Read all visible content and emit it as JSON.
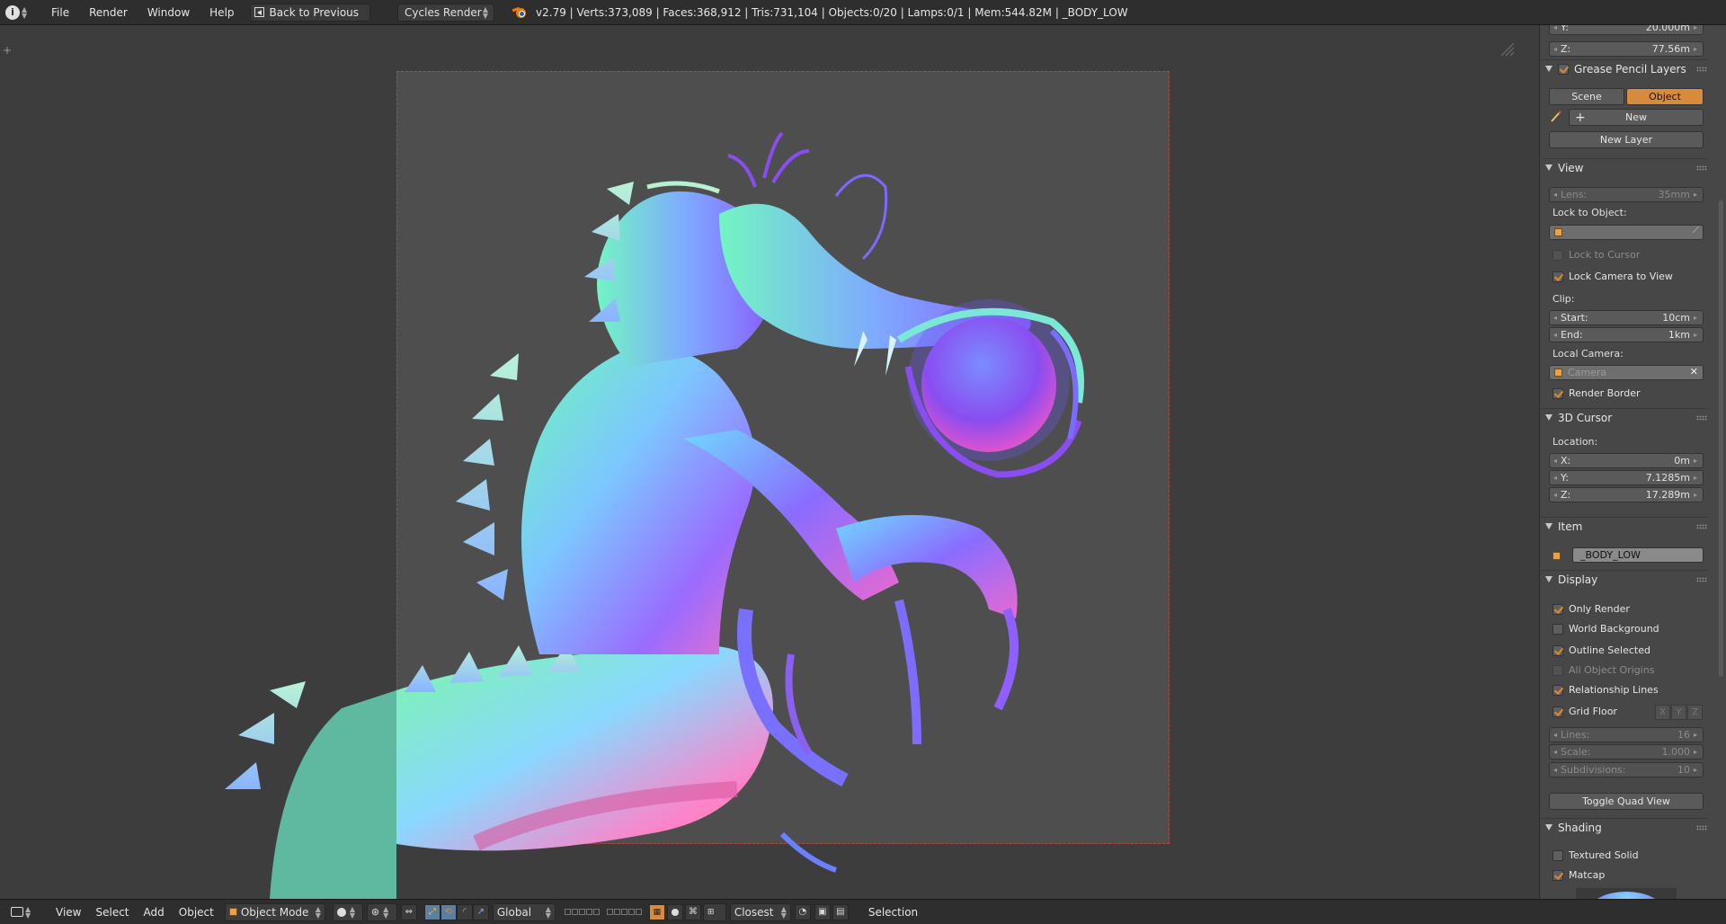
{
  "topbar": {
    "menu": [
      "File",
      "Render",
      "Window",
      "Help"
    ],
    "back_label": "Back to Previous",
    "render_engine": "Cycles Render",
    "stats": "v2.79 | Verts:373,089 | Faces:368,912 | Tris:731,104 | Objects:0/20 | Lamps:0/1 | Mem:544.82M | _BODY_LOW"
  },
  "npanel": {
    "partial_y_label": "Y:",
    "partial_y_value": "20.000m",
    "z_label": "Z:",
    "z_value": "77.56m",
    "grease": {
      "title": "Grease Pencil Layers",
      "scene_tab": "Scene",
      "object_tab": "Object",
      "new_label": "New",
      "new_layer_label": "New Layer"
    },
    "view": {
      "title": "View",
      "lens_label": "Lens:",
      "lens_value": "35mm",
      "lock_to_object_label": "Lock to Object:",
      "lock_to_cursor_label": "Lock to Cursor",
      "lock_camera_label": "Lock Camera to View",
      "clip_label": "Clip:",
      "start_label": "Start:",
      "start_value": "10cm",
      "end_label": "End:",
      "end_value": "1km",
      "local_camera_label": "Local Camera:",
      "local_camera_placeholder": "Camera",
      "render_border_label": "Render Border"
    },
    "cursor": {
      "title": "3D Cursor",
      "location_label": "Location:",
      "x_label": "X:",
      "x_value": "0m",
      "y_label": "Y:",
      "y_value": "7.1285m",
      "z_label": "Z:",
      "z_value": "17.289m"
    },
    "item": {
      "title": "Item",
      "name": "_BODY_LOW"
    },
    "display": {
      "title": "Display",
      "only_render": "Only Render",
      "world_background": "World Background",
      "outline_selected": "Outline Selected",
      "all_object_origins": "All Object Origins",
      "relationship_lines": "Relationship Lines",
      "grid_floor": "Grid Floor",
      "axis_x": "X",
      "axis_y": "Y",
      "axis_z": "Z",
      "lines_label": "Lines:",
      "lines_value": "16",
      "scale_label": "Scale:",
      "scale_value": "1.000",
      "subdivisions_label": "Subdivisions:",
      "subdivisions_value": "10",
      "toggle_quad_view": "Toggle Quad View"
    },
    "shading": {
      "title": "Shading",
      "textured_solid": "Textured Solid",
      "matcap": "Matcap"
    }
  },
  "bottombar": {
    "menu": [
      "View",
      "Select",
      "Add",
      "Object"
    ],
    "mode": "Object Mode",
    "orientation": "Global",
    "snap_target": "Closest",
    "selection_label": "Selection"
  },
  "colors": {
    "accent": "#d88b3c",
    "camera_border": "#b5463f",
    "header_bg": "#2e2e2e",
    "panel_bg": "#474747",
    "viewport_bg": "#3d3d3d"
  }
}
